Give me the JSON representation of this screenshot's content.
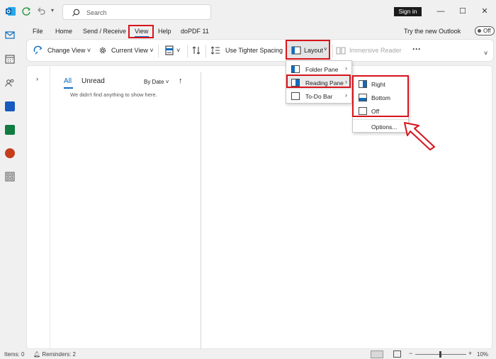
{
  "title_bar": {
    "search_placeholder": "Search",
    "sign_in": "Sign in"
  },
  "menu": [
    "File",
    "Home",
    "Send / Receive",
    "View",
    "Help",
    "doPDF 11"
  ],
  "new_outlook": {
    "label": "Try the new Outlook",
    "toggle": "Off"
  },
  "ribbon": {
    "change_view": "Change View",
    "current_view": "Current View",
    "tighter_spacing": "Use Tighter Spacing",
    "layout": "Layout",
    "immersive_reader": "Immersive Reader",
    "more": "···"
  },
  "layout_menu": {
    "folder_pane": "Folder Pane",
    "reading_pane": "Reading Pane",
    "todo_bar": "To-Do Bar"
  },
  "reading_pane_menu": {
    "right": "Right",
    "bottom": "Bottom",
    "off": "Off",
    "options": "Options..."
  },
  "message_list": {
    "tab_all": "All",
    "tab_unread": "Unread",
    "sort": "By Date",
    "empty_text": "We didn't find anything to show here."
  },
  "status": {
    "items": "Items: 0",
    "reminders": "Reminders: 2",
    "zoom": "10%"
  },
  "colors": {
    "accent": "#0f6cbd",
    "annotation_red": "#d7141c"
  }
}
